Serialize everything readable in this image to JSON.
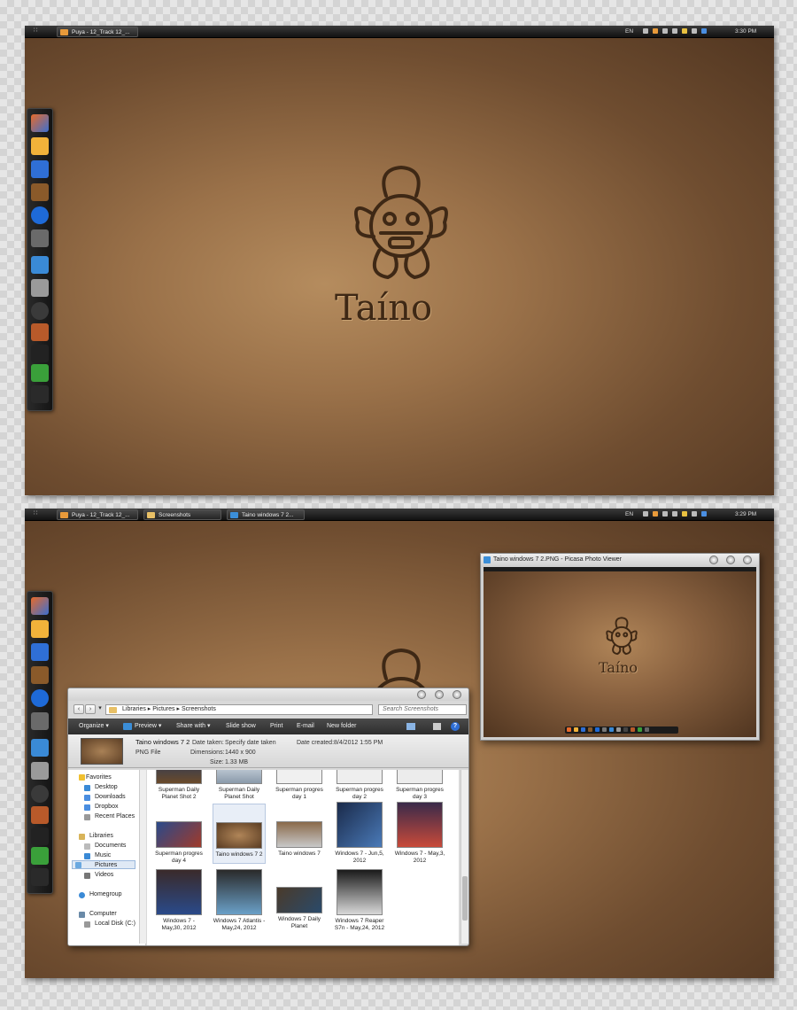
{
  "desktop1": {
    "taskbar": {
      "start_glyph": "∷",
      "buttons": [
        {
          "label": "Puya - 12_Track 12_..."
        }
      ],
      "language": "EN",
      "clock": "3:30 PM"
    },
    "logo_text": "Taíno"
  },
  "desktop2": {
    "taskbar": {
      "start_glyph": "∷",
      "buttons": [
        {
          "label": "Puya - 12_Track 12_..."
        },
        {
          "label": "Screenshots"
        },
        {
          "label": "Taino windows 7 2..."
        }
      ],
      "language": "EN",
      "clock": "3:29 PM"
    },
    "logo_text": "Taíno"
  },
  "explorer": {
    "nav": {
      "back": "‹",
      "forward": "›",
      "dropdown": "▾"
    },
    "breadcrumb": "Libraries ▸ Pictures ▸ Screenshots",
    "search_placeholder": "Search Screenshots",
    "toolbar": {
      "organize": "Organize ▾",
      "preview": "Preview ▾",
      "share": "Share with ▾",
      "slideshow": "Slide show",
      "print": "Print",
      "email": "E-mail",
      "new_folder": "New folder",
      "help": "?"
    },
    "details": {
      "filename": "Taino windows 7 2",
      "filetype": "PNG File",
      "date_taken_label": "Date taken:",
      "date_taken_value": "Specify date taken",
      "dimensions_label": "Dimensions:",
      "dimensions_value": "1440 x 900",
      "size_label": "Size:",
      "size_value": "1.33 MB",
      "date_created_label": "Date created:",
      "date_created_value": "8/4/2012 1:55 PM"
    },
    "nav_pane": {
      "favorites": "Favorites",
      "favorites_items": [
        "Desktop",
        "Downloads",
        "Dropbox",
        "Recent Places"
      ],
      "libraries": "Libraries",
      "libraries_items": [
        "Documents",
        "Music",
        "Pictures",
        "Videos"
      ],
      "homegroup": "Homegroup",
      "computer": "Computer",
      "computer_items": [
        "Local Disk (C:)"
      ]
    },
    "files": [
      {
        "caption": "Superman Daily Planet Shot 2"
      },
      {
        "caption": "Superman Daily Planet Shot"
      },
      {
        "caption": "Superman progres day 1"
      },
      {
        "caption": "Superman progres day 2"
      },
      {
        "caption": "Superman progres day 3"
      },
      {
        "caption": "Superman progres day 4"
      },
      {
        "caption": "Taino windows 7 2"
      },
      {
        "caption": "Taino windows 7"
      },
      {
        "caption": "Windows 7 - Jun,5, 2012"
      },
      {
        "caption": "Windows 7 - May,3, 2012"
      },
      {
        "caption": "Windows 7 - May,30, 2012"
      },
      {
        "caption": "Windows 7 Atlantis - May,24, 2012"
      },
      {
        "caption": "Windows 7 Daily Planet"
      },
      {
        "caption": "Windows 7 Reaper S7n - May,24, 2012"
      }
    ]
  },
  "picasa": {
    "title": "Taino windows 7 2.PNG - Picasa Photo Viewer",
    "logo_text": "Taíno"
  }
}
